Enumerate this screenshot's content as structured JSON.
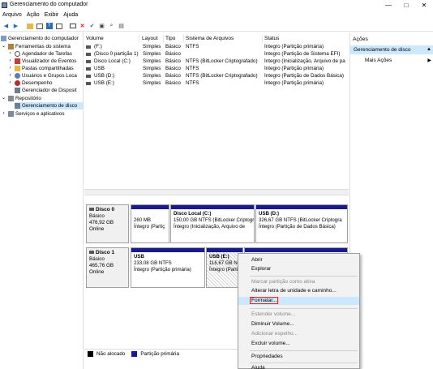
{
  "window": {
    "title": "Gerenciamento do computador",
    "controls": [
      "—",
      "□",
      "✕"
    ]
  },
  "menu": [
    "Arquivo",
    "Ação",
    "Exibir",
    "Ajuda"
  ],
  "toolbar": [
    "back-icon",
    "forward-icon",
    "up-icon",
    "show-hide-tree-icon",
    "help-icon",
    "console-icon",
    "properties-icon",
    "delete-icon",
    "check-icon",
    "open-icon",
    "search-icon",
    "more-icon"
  ],
  "tree": [
    {
      "label": "Gerenciamento do computador",
      "level": 0,
      "icon": "computer-icon"
    },
    {
      "label": "Ferramentas do sistema",
      "level": 1,
      "icon": "tools-icon",
      "expander": "⌄"
    },
    {
      "label": "Agendador de Tarefas",
      "level": 2,
      "icon": "clock-icon",
      "expander": "›"
    },
    {
      "label": "Visualizador de Eventos",
      "level": 2,
      "icon": "events-icon",
      "expander": "›"
    },
    {
      "label": "Pastas compartilhadas",
      "level": 2,
      "icon": "folder-icon",
      "expander": "›"
    },
    {
      "label": "Usuários e Grupos Loca",
      "level": 2,
      "icon": "users-icon",
      "expander": "›"
    },
    {
      "label": "Desempenho",
      "level": 2,
      "icon": "performance-icon",
      "expander": "›"
    },
    {
      "label": "Gerenciador de Disposit",
      "level": 2,
      "icon": "devices-icon"
    },
    {
      "label": "Repositório",
      "level": 1,
      "icon": "storage-icon",
      "expander": "⌄"
    },
    {
      "label": "Gerenciamento de disco",
      "level": 2,
      "icon": "disk-icon",
      "selected": true
    },
    {
      "label": "Serviços e aplicativos",
      "level": 1,
      "icon": "services-icon",
      "expander": "›"
    }
  ],
  "volume_list": {
    "headers": [
      "Volume",
      "Layout",
      "Tipo",
      "Sistema de Arquivos",
      "Status"
    ],
    "rows": [
      [
        "(F:)",
        "Simples",
        "Básico",
        "NTFS",
        "Íntegro (Partição primária)"
      ],
      [
        "(Disco 0 partição 1)",
        "Simples",
        "Básico",
        "",
        "Íntegro (Partição de Sistema EFI)"
      ],
      [
        "Disco Local (C:)",
        "Simples",
        "Básico",
        "NTFS (BitLocker Criptografado)",
        "Íntegro (Inicialização, Arquivo de pa"
      ],
      [
        "USB",
        "Simples",
        "Básico",
        "NTFS",
        "Íntegro (Partição primária)"
      ],
      [
        "USB (D:)",
        "Simples",
        "Básico",
        "NTFS (BitLocker Criptografado)",
        "Íntegro (Partição de Dados Básica)"
      ],
      [
        "USB (E:)",
        "Simples",
        "Básico",
        "NTFS",
        "Íntegro (Partição primária)"
      ]
    ]
  },
  "disks": [
    {
      "name": "Disco 0",
      "type": "Básico",
      "size": "476,92 GB",
      "status": "Online",
      "partitions": [
        {
          "lines": [
            "",
            "260 MB",
            "Íntegro (Partiç"
          ]
        },
        {
          "lines": [
            "Disco Local  (C:)",
            "150,00 GB NTFS (BitLocker Criptogr",
            "Íntegro (Inicialização, Arquivo de"
          ]
        },
        {
          "lines": [
            "USB  (D:)",
            "326,67 GB NTFS (BitLocker Criptogra",
            "Íntegro (Partição de Dados Básica)"
          ]
        }
      ]
    },
    {
      "name": "Disco 1",
      "type": "Básico",
      "size": "465,76 GB",
      "status": "Online",
      "partitions": [
        {
          "lines": [
            "USB",
            "233,08 GB NTFS",
            "Íntegro (Partição primária)"
          ]
        },
        {
          "lines": [
            "USB  (E:)",
            "116,67 GB NTFS",
            "Íntegro (Partiç"
          ]
        },
        {
          "lines": [
            "",
            "",
            ""
          ]
        }
      ]
    }
  ],
  "legend": [
    {
      "label": "Não alocado",
      "color": "#000000"
    },
    {
      "label": "Partição primária",
      "color": "#1a1a8c"
    }
  ],
  "actions": {
    "header": "Ações",
    "selected": "Gerenciamento de disco",
    "more": "Mais Ações"
  },
  "context_menu": [
    {
      "label": "Abrir",
      "disabled": false
    },
    {
      "label": "Explorar",
      "disabled": false
    },
    {
      "sep": true
    },
    {
      "label": "Marcar partição como ativa",
      "disabled": true
    },
    {
      "label": "Alterar letra de unidade e caminho...",
      "disabled": false
    },
    {
      "label": "Formatar...",
      "disabled": false,
      "highlighted": true
    },
    {
      "sep": true
    },
    {
      "label": "Estender volume...",
      "disabled": true
    },
    {
      "label": "Diminuir Volume...",
      "disabled": false
    },
    {
      "label": "Adicionar espelho...",
      "disabled": true
    },
    {
      "label": "Excluir volume...",
      "disabled": false
    },
    {
      "sep": true
    },
    {
      "label": "Propriedades",
      "disabled": false
    },
    {
      "sep": true
    },
    {
      "label": "Ajuda",
      "disabled": false
    }
  ],
  "colors": {
    "partition_bar": "#1a1a8c",
    "selection": "#cce8ff",
    "highlight_border": "#d9262c"
  }
}
